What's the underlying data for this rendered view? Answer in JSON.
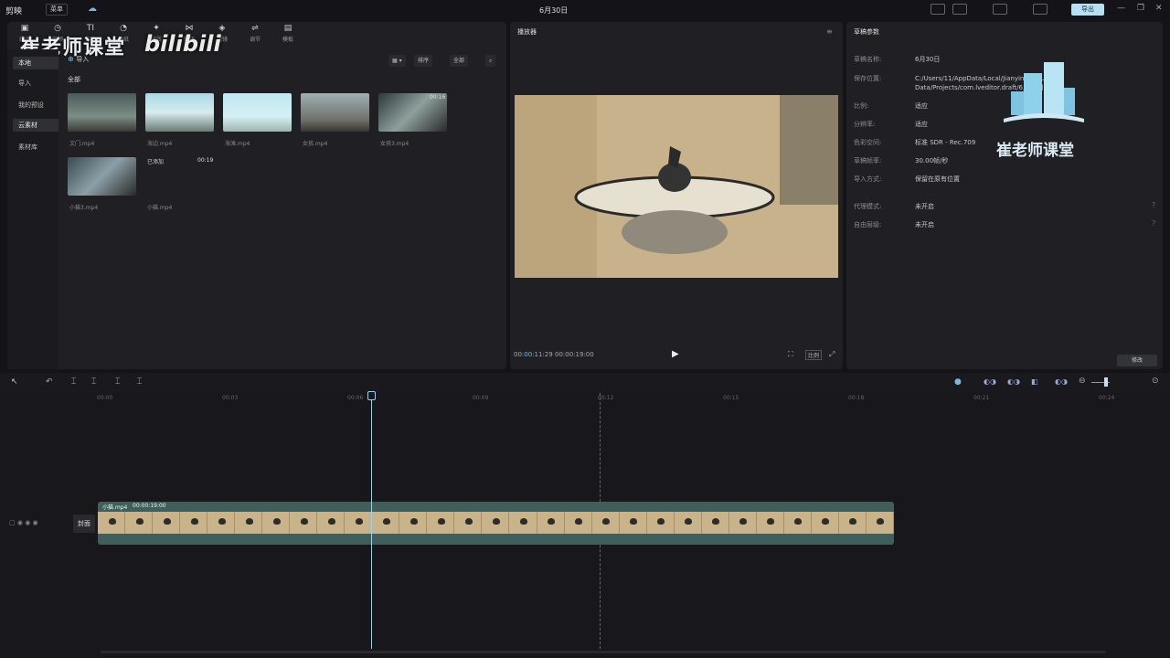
{
  "titlebar": {
    "app_name": "剪映",
    "menu_label": "菜单",
    "title": "6月30日",
    "share_label": "导出"
  },
  "toolbar": {
    "tools": [
      {
        "icon": "media-icon",
        "label": "媒体"
      },
      {
        "icon": "audio-icon",
        "label": "音频"
      },
      {
        "icon": "text-icon",
        "label": "文本"
      },
      {
        "icon": "sticker-icon",
        "label": "贴纸"
      },
      {
        "icon": "effect-icon",
        "label": "特效"
      },
      {
        "icon": "transition-icon",
        "label": "转场"
      },
      {
        "icon": "filter-icon",
        "label": "滤镜"
      },
      {
        "icon": "adjust-icon",
        "label": "调节"
      },
      {
        "icon": "template-icon",
        "label": "模板"
      }
    ]
  },
  "watermark": {
    "left_cn": "崔老师课堂",
    "left_bili": "bilibili",
    "right_cn": "崔老师课堂"
  },
  "sidebar": {
    "items": [
      {
        "label": "本地",
        "active": true
      },
      {
        "label": "导入",
        "active": false
      },
      {
        "label": "我的预设",
        "active": false
      },
      {
        "label": "云素材",
        "active": false
      },
      {
        "label": "素材库",
        "active": false
      }
    ]
  },
  "media": {
    "import_label": "导入",
    "sort_label": "排序",
    "all_filter_label": "全部",
    "all_section_label": "全部",
    "items": [
      {
        "name": "文门.mp4",
        "duration": ""
      },
      {
        "name": "海边.mp4",
        "duration": ""
      },
      {
        "name": "海滩.mp4",
        "duration": ""
      },
      {
        "name": "女孩.mp4",
        "duration": ""
      },
      {
        "name": "女孩3.mp4",
        "duration": "00:16"
      },
      {
        "name": "小猫3.mp4",
        "duration": ""
      },
      {
        "name": "小猫.mp4",
        "duration": "00:19",
        "badge": "已添加"
      }
    ]
  },
  "player": {
    "title": "播放器",
    "current_time": "00:00:11:29",
    "total_time": "00:00:19:00",
    "ratio_label": "比例"
  },
  "properties": {
    "title": "草稿参数",
    "rows": [
      {
        "label": "草稿名称:",
        "value": "6月30日"
      },
      {
        "label": "保存位置:",
        "value": "C:/Users/11/AppData/Local/JianyingPro/User Data/Projects/com.lveditor.draft/6月30日"
      },
      {
        "label": "比例:",
        "value": "适应"
      },
      {
        "label": "分辨率:",
        "value": "适应"
      },
      {
        "label": "色彩空间:",
        "value": "标准 SDR - Rec.709"
      },
      {
        "label": "草稿帧率:",
        "value": "30.00帧/秒"
      },
      {
        "label": "导入方式:",
        "value": "保留在原有位置"
      },
      {
        "label": "代理模式:",
        "value": "未开启"
      },
      {
        "label": "自由层级:",
        "value": "未开启"
      }
    ],
    "edit_label": "修改"
  },
  "timeline": {
    "ticks": [
      "00:00",
      "00:03",
      "00:06",
      "00:09",
      "00:12",
      "00:15",
      "00:18",
      "00:21",
      "00:24"
    ],
    "clip_name": "小猫.mp4",
    "clip_duration": "00:00:19:00",
    "cover_label": "封面"
  }
}
